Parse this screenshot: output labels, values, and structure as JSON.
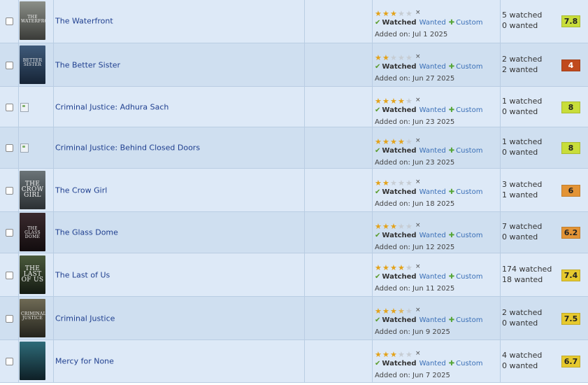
{
  "colors": {
    "row_odd": "#dde9f7",
    "row_even": "#cfdff0",
    "link": "#1f3f8f",
    "star": "#e3a21a",
    "score_high": "#c8dd3a",
    "score_mid": "#e6c92e",
    "score_orange": "#e39436",
    "score_low": "#c04a1e"
  },
  "labels": {
    "watched": "Watched",
    "wanted": "Wanted",
    "custom": "Custom",
    "clear": "×"
  },
  "rows": [
    {
      "title": "The Waterfront",
      "poster_text": "THE WATERFRONT",
      "poster_colors": [
        "#8b8f88",
        "#3a3b38"
      ],
      "stars": 3,
      "added": "Added on: Jul 1 2025",
      "watched": "5 watched",
      "wanted": "0 wanted",
      "score": "7.8",
      "score_color": "#c8dd3a"
    },
    {
      "title": "The Better Sister",
      "poster_text": "BETTER SISTER",
      "poster_colors": [
        "#3f5a7a",
        "#162436"
      ],
      "stars": 2,
      "added": "Added on: Jun 27 2025",
      "watched": "2 watched",
      "wanted": "2 wanted",
      "score": "4",
      "score_color": "#c04a1e"
    },
    {
      "title": "Criminal Justice: Adhura Sach",
      "poster_text": "",
      "poster_colors": [],
      "stars": 4,
      "added": "Added on: Jun 23 2025",
      "watched": "1 watched",
      "wanted": "0 wanted",
      "score": "8",
      "score_color": "#c8dd3a"
    },
    {
      "title": "Criminal Justice: Behind Closed Doors",
      "poster_text": "",
      "poster_colors": [],
      "stars": 4,
      "added": "Added on: Jun 23 2025",
      "watched": "1 watched",
      "wanted": "0 wanted",
      "score": "8",
      "score_color": "#c8dd3a"
    },
    {
      "title": "The Crow Girl",
      "poster_text": "THE CROW GIRL",
      "poster_colors": [
        "#6b7478",
        "#2b3033"
      ],
      "stars": 2,
      "added": "Added on: Jun 18 2025",
      "watched": "3 watched",
      "wanted": "1 wanted",
      "score": "6",
      "score_color": "#e39436"
    },
    {
      "title": "The Glass Dome",
      "poster_text": "THE GLASS DOME",
      "poster_colors": [
        "#3a2a2e",
        "#120c0e"
      ],
      "stars": 3,
      "added": "Added on: Jun 12 2025",
      "watched": "7 watched",
      "wanted": "0 wanted",
      "score": "6.2",
      "score_color": "#e39436"
    },
    {
      "title": "The Last of Us",
      "poster_text": "THE LAST OF US",
      "poster_colors": [
        "#4a5a3c",
        "#141a12"
      ],
      "stars": 4,
      "added": "Added on: Jun 11 2025",
      "watched": "174 watched",
      "wanted": "18 wanted",
      "score": "7.4",
      "score_color": "#e6c92e"
    },
    {
      "title": "Criminal Justice",
      "poster_text": "CRIMINAL JUSTICE",
      "poster_colors": [
        "#6f6a55",
        "#23231c"
      ],
      "stars": 3.5,
      "added": "Added on: Jun 9 2025",
      "watched": "2 watched",
      "wanted": "0 wanted",
      "score": "7.5",
      "score_color": "#e6c92e"
    },
    {
      "title": "Mercy for None",
      "poster_text": "",
      "poster_colors": [
        "#2e6b78",
        "#0e1f26"
      ],
      "stars": 3,
      "added": "Added on: Jun 7 2025",
      "watched": "4 watched",
      "wanted": "0 wanted",
      "score": "6.7",
      "score_color": "#e6c92e"
    }
  ]
}
